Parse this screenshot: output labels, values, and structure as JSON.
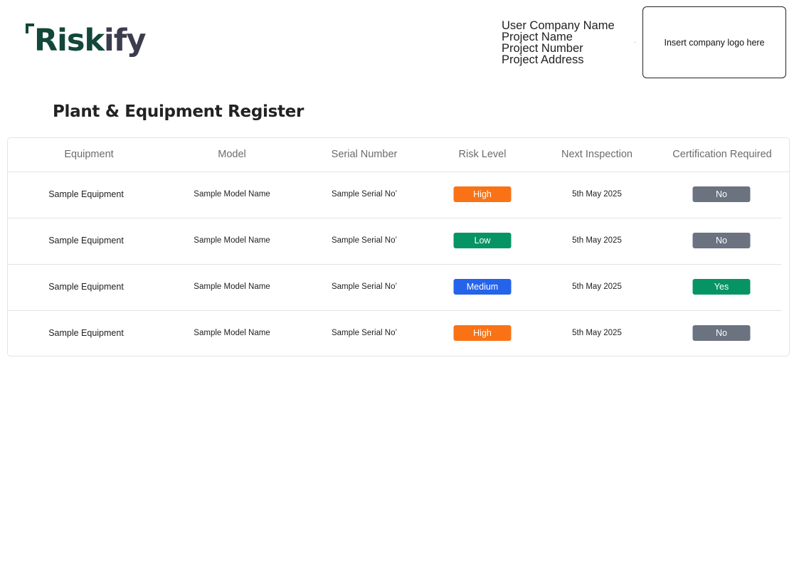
{
  "brand": {
    "logo_prefix": "Risk",
    "logo_suffix": "ify",
    "colors": {
      "dark": "#12473a",
      "grey": "#3b3d4e"
    }
  },
  "project": {
    "company_name": "User Company Name",
    "project_name": "Project Name",
    "project_number": "Project Number",
    "project_address": "Project Address",
    "logo_placeholder": "Insert company logo here"
  },
  "page_title": "Plant & Equipment Register",
  "table": {
    "headers": [
      "Equipment",
      "Model",
      "Serial Number",
      "Risk Level",
      "Next Inspection",
      "Certification Required"
    ],
    "rows": [
      {
        "equipment": "Sample Equipment",
        "model": "Sample Model Name",
        "serial": "Sample Serial No’",
        "risk": "High",
        "next_inspection": "5th May 2025",
        "certification": "No"
      },
      {
        "equipment": "Sample Equipment",
        "model": "Sample Model Name",
        "serial": "Sample Serial No’",
        "risk": "Low",
        "next_inspection": "5th May 2025",
        "certification": "No"
      },
      {
        "equipment": "Sample Equipment",
        "model": "Sample Model Name",
        "serial": "Sample Serial No’",
        "risk": "Medium",
        "next_inspection": "5th May 2025",
        "certification": "Yes"
      },
      {
        "equipment": "Sample Equipment",
        "model": "Sample Model Name",
        "serial": "Sample Serial No’",
        "risk": "High",
        "next_inspection": "5th May 2025",
        "certification": "No"
      }
    ]
  },
  "status_colors": {
    "High": "#f97316",
    "Low": "#079465",
    "Medium": "#2563eb",
    "Yes": "#079465",
    "No": "#6b7280"
  }
}
